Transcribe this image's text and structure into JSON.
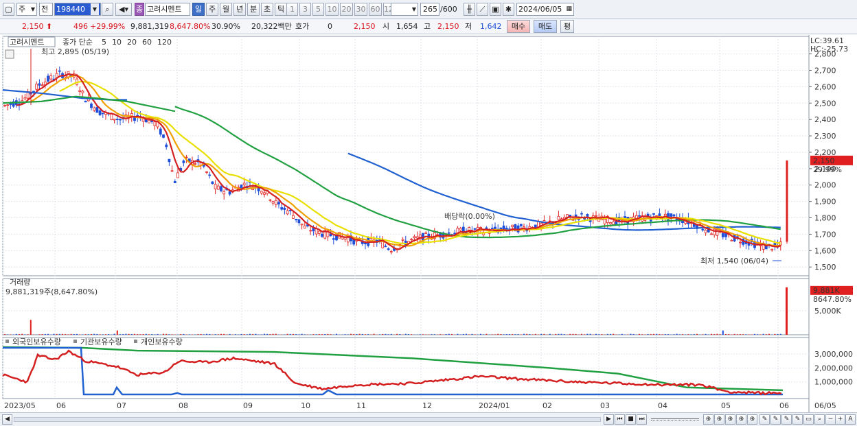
{
  "toolbar": {
    "market_sel": "주",
    "market_sel2": "전",
    "code": "198440",
    "stock_badge": "종",
    "stock_name": "고려시멘트",
    "periods": [
      "일",
      "주",
      "월",
      "년",
      "분",
      "초",
      "틱"
    ],
    "active_period": "일",
    "intervals": [
      "1",
      "3",
      "5",
      "10",
      "20",
      "30",
      "60",
      "120"
    ],
    "count": "265",
    "count_total": "/600",
    "date": "2024/06/05"
  },
  "quote": {
    "price": "2,150",
    "change": "496",
    "change_pct": "+29.99%",
    "volume": "9,881,319",
    "volume_pct": "8,647.80%",
    "turnover_pct": "30.90%",
    "amount": "20,322백만",
    "hoga_label": "호가",
    "hoga_value": "0",
    "hoga_price": "2,150",
    "open_label": "시",
    "open": "1,654",
    "high_label": "고",
    "high": "2,150",
    "low_label": "저",
    "low": "1,642",
    "buy_label": "매수",
    "sell_label": "매도",
    "eval_label": "평"
  },
  "price_panel": {
    "name": "고려시멘트",
    "legend_prefix": "종가 단순",
    "ma_legend": [
      {
        "label": "5",
        "color": "#d42020"
      },
      {
        "label": "10",
        "color": "#f0a000"
      },
      {
        "label": "20",
        "color": "#e8e000"
      },
      {
        "label": "60",
        "color": "#20a040"
      },
      {
        "label": "120",
        "color": "#2060d0"
      }
    ],
    "high_note": "최고 2,895 (05/19)",
    "low_note": "최저 1,540 (06/04)",
    "dividend_note": "배당락(0.00%)",
    "lc": "LC:39.61",
    "hc": "HC:-25.73",
    "current_tag": "2,150",
    "current_pct": "29.99%",
    "y_ticks": [
      "2,800",
      "2,700",
      "2,600",
      "2,500",
      "2,400",
      "2,300",
      "2,200",
      "2,100",
      "2,000",
      "1,900",
      "1,800",
      "1,700",
      "1,600",
      "1,500"
    ]
  },
  "volume_panel": {
    "title": "거래량",
    "value_note": "9,881,319주(8,647.80%)",
    "tag": "9,881K",
    "tag_pct": "8647.80%",
    "y_ticks": [
      "5,000K"
    ]
  },
  "holding_panel": {
    "legends": [
      {
        "label": "외국인보유수량",
        "color": "#d42020"
      },
      {
        "label": "기관보유수량",
        "color": "#2060d0"
      },
      {
        "label": "개인보유수량",
        "color": "#20a040"
      }
    ],
    "y_ticks": [
      "3,000,000",
      "2,000,000",
      "1,000,000"
    ]
  },
  "x_axis": [
    "2023/05",
    "06",
    "07",
    "08",
    "09",
    "10",
    "11",
    "12",
    "2024/01",
    "02",
    "03",
    "04",
    "05",
    "06",
    "06/05"
  ]
}
